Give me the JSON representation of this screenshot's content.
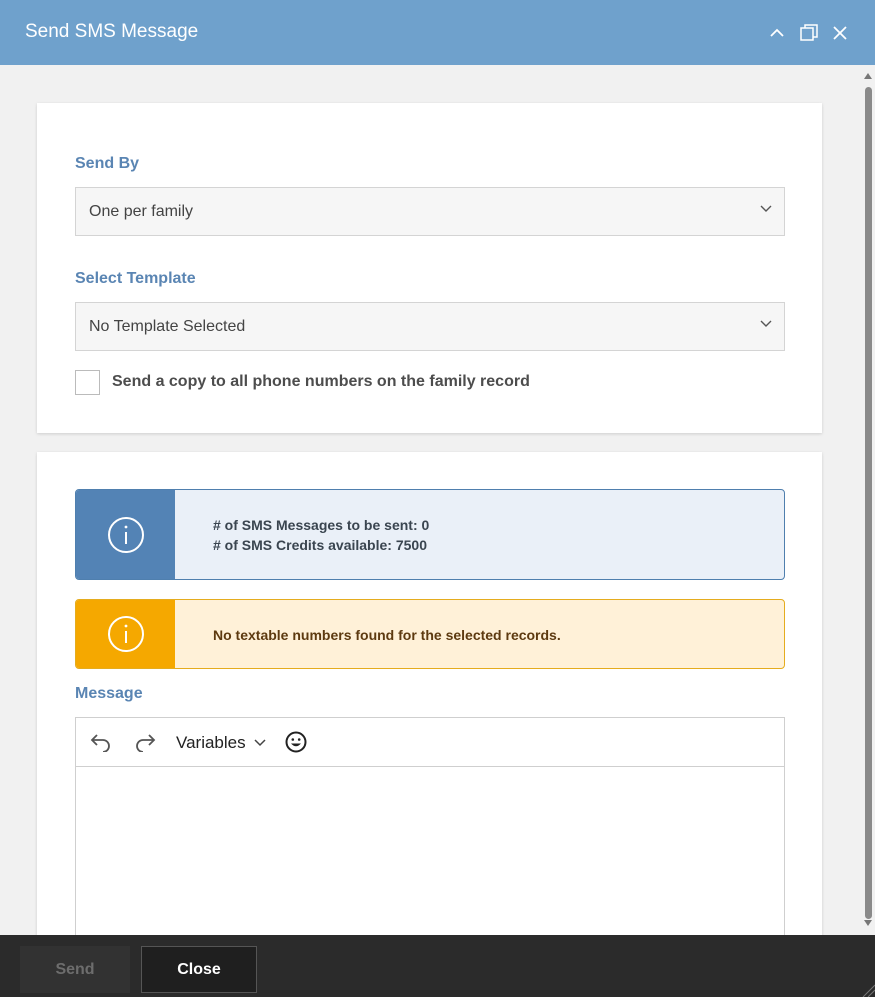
{
  "dialog": {
    "title": "Send SMS Message",
    "controls": {
      "minimize_icon": "chevron-up-icon",
      "maximize_icon": "restore-icon",
      "close_icon": "close-icon"
    }
  },
  "form": {
    "send_by": {
      "label": "Send By",
      "value": "One per family"
    },
    "template": {
      "label": "Select Template",
      "value": "No Template Selected"
    },
    "copy_all": {
      "label": "Send a copy to all phone numbers on the family record",
      "checked": false
    }
  },
  "alerts": {
    "info": {
      "line1": "# of SMS Messages to be sent: 0",
      "line2": "# of SMS Credits available: 7500",
      "color": "#5383b5"
    },
    "warning": {
      "text": "No textable numbers found for the selected records.",
      "color": "#f5a800"
    }
  },
  "message": {
    "label": "Message",
    "toolbar": {
      "undo_icon": "undo-icon",
      "redo_icon": "redo-icon",
      "variables_label": "Variables",
      "emoji_icon": "emoji-icon"
    },
    "body": ""
  },
  "footer": {
    "send_label": "Send",
    "close_label": "Close"
  },
  "colors": {
    "titlebar": "#6fa1cc",
    "accent_label": "#5a85b3",
    "footer": "#2b2b2b"
  }
}
